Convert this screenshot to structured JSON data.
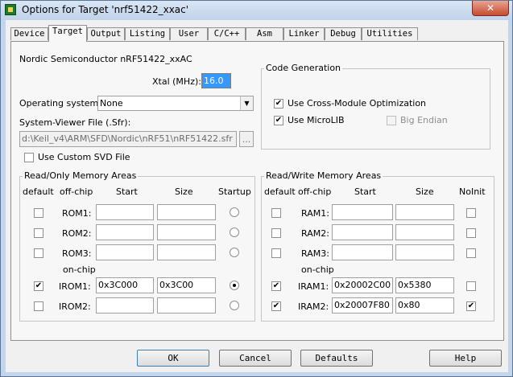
{
  "window": {
    "title": "Options for Target 'nrf51422_xxac'",
    "close_glyph": "✕"
  },
  "tabs": [
    "Device",
    "Target",
    "Output",
    "Listing",
    "User",
    "C/C++",
    "Asm",
    "Linker",
    "Debug",
    "Utilities"
  ],
  "target": {
    "device_name": "Nordic Semiconductor nRF51422_xxAC",
    "xtal_label": "Xtal (MHz):",
    "xtal_value": "16.0",
    "os_label": "Operating system:",
    "os_value": "None",
    "sfr_label": "System-Viewer File (.Sfr):",
    "sfr_value": "d:\\Keil_v4\\ARM\\SFD\\Nordic\\nRF51\\nRF51422.sfr",
    "browse_label": "...",
    "custom_svd_label": "Use Custom SVD File"
  },
  "code_gen": {
    "title": "Code Generation",
    "cross_module": "Use Cross-Module Optimization",
    "microlib": "Use MicroLIB",
    "big_endian": "Big Endian"
  },
  "rom": {
    "title": "Read/Only Memory Areas",
    "headers": {
      "default": "default",
      "offchip": "off-chip",
      "start": "Start",
      "size": "Size",
      "startup": "Startup"
    },
    "onchip_label": "on-chip",
    "rows": [
      {
        "name": "ROM1:",
        "start": "",
        "size": ""
      },
      {
        "name": "ROM2:",
        "start": "",
        "size": ""
      },
      {
        "name": "ROM3:",
        "start": "",
        "size": ""
      },
      {
        "name": "IROM1:",
        "start": "0x3C000",
        "size": "0x3C00"
      },
      {
        "name": "IROM2:",
        "start": "",
        "size": ""
      }
    ]
  },
  "ram": {
    "title": "Read/Write Memory Areas",
    "headers": {
      "default": "default",
      "offchip": "off-chip",
      "start": "Start",
      "size": "Size",
      "noinit": "NoInit"
    },
    "onchip_label": "on-chip",
    "rows": [
      {
        "name": "RAM1:",
        "start": "",
        "size": ""
      },
      {
        "name": "RAM2:",
        "start": "",
        "size": ""
      },
      {
        "name": "RAM3:",
        "start": "",
        "size": ""
      },
      {
        "name": "IRAM1:",
        "start": "0x20002C00",
        "size": "0x5380"
      },
      {
        "name": "IRAM2:",
        "start": "0x20007F80",
        "size": "0x80"
      }
    ]
  },
  "buttons": {
    "ok": "OK",
    "cancel": "Cancel",
    "defaults": "Defaults",
    "help": "Help"
  },
  "check_glyph": "✔",
  "dropdown_glyph": "▼"
}
